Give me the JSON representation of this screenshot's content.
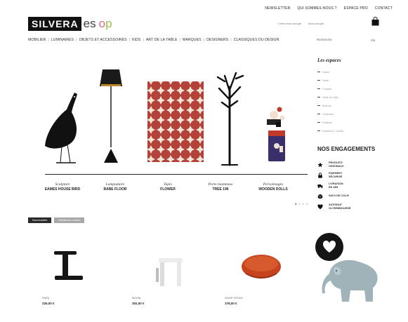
{
  "topnav": [
    "NEWSLETTER",
    "QUI SOMMES-NOUS ?",
    "ESPACE PRO",
    "CONTACT"
  ],
  "logo": {
    "box": "SILVERA",
    "es": "es",
    "o": "o",
    "p": "p"
  },
  "account": [
    "Créer mon compte",
    "Mon compte"
  ],
  "mainnav": [
    "MOBILIER",
    "LUMINAIRES",
    "OBJETS ET ACCESSOIRES",
    "KIDS",
    "ART DE LA TABLE",
    "MARQUES",
    "DESIGNERS",
    "CLASSIQUES DU DESIGN"
  ],
  "search": {
    "label": "Recherche",
    "ok": "OK"
  },
  "hero": {
    "captions": [
      {
        "category": "Sculpture",
        "name": "EAMES HOUSE BIRD"
      },
      {
        "category": "Lampadaire",
        "name": "BABE FLOOR"
      },
      {
        "category": "Tapis",
        "name": "FLOWER"
      },
      {
        "category": "Porte manteaux",
        "name": "TREE 196"
      },
      {
        "category": "Personnages",
        "name": "WOODEN DOLLS"
      }
    ],
    "pager": [
      "1",
      "2",
      "3",
      "4"
    ]
  },
  "sidebar": {
    "title": "Les espaces",
    "items": [
      "Salon",
      "Salle",
      "Cuisine",
      "Salle de bain",
      "Bureau",
      "Chambre",
      "Enfants",
      "Extérieur / Jardin"
    ]
  },
  "engagements": {
    "title": "NOS ENGAGEMENTS",
    "items": [
      {
        "icon": "star-icon",
        "line1": "PRODUITS",
        "line2": "ORIGINAUX"
      },
      {
        "icon": "lock-icon",
        "line1": "PAIEMENT",
        "line2": "SÉCURISÉ"
      },
      {
        "icon": "truck-icon",
        "line1": "LIVRAISON",
        "line2": "EN 48H"
      },
      {
        "icon": "package-icon",
        "line1": "SUIVI DE COLIS",
        "line2": ""
      },
      {
        "icon": "heart-icon",
        "line1": "SATISFAIT",
        "line2": "OU REMBOURSÉ"
      }
    ]
  },
  "tabs": [
    "Nouveautés",
    "Meilleures ventes"
  ],
  "products": [
    {
      "label": "PAPA",
      "price": "225,00 €"
    },
    {
      "label": "MOON",
      "price": "302,00 €"
    },
    {
      "label": "HOOP STOOL",
      "price": "378,00 €"
    }
  ]
}
